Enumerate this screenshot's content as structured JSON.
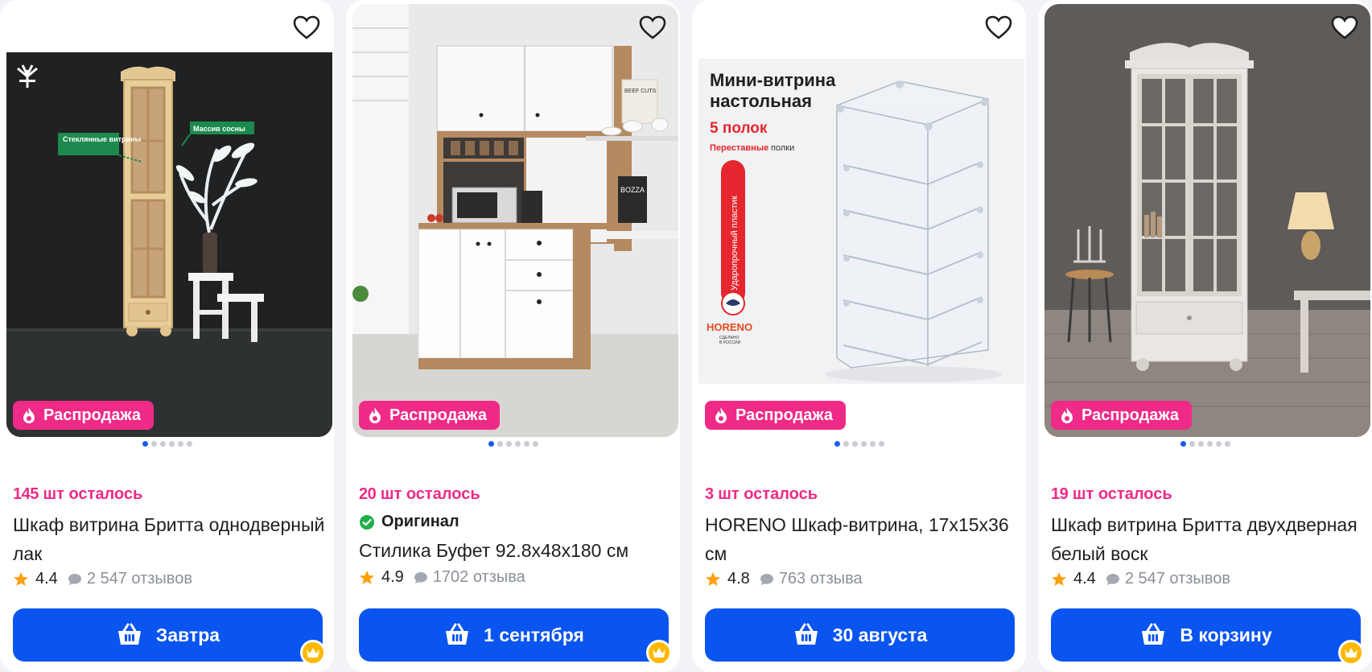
{
  "colors": {
    "accent_blue": "#0a55f0",
    "sale_pink": "#ef2a87",
    "stock_pink": "#ef2a87",
    "star_orange": "#ff9f0a",
    "muted_text": "#8a8f99",
    "premium_yellow": "#ffb800"
  },
  "products": [
    {
      "image_texts": {
        "label_left": "Стеклянные витрины",
        "label_right": "Массив сосны"
      },
      "badge": "Распродажа",
      "stock_num": "145",
      "stock_text": "шт осталось",
      "title": "Шкаф витрина Бритта однодверный лак",
      "rating": "4.4",
      "reviews": "2 547 отзывов",
      "button": "Завтра"
    },
    {
      "image_texts": {
        "board": "BEEF CUTS",
        "box": "BOZZA"
      },
      "badge": "Распродажа",
      "stock_num": "20",
      "stock_text": "шт осталось",
      "original": "Оригинал",
      "title": "Стилика Буфет 92.8x48x180 см",
      "rating": "4.9",
      "reviews": "1702 отзыва",
      "button": "1 сентября"
    },
    {
      "image_texts": {
        "headline_1": "Мини-витрина",
        "headline_2": "настольная",
        "shelves": "5 полок",
        "movable_bold": "Переставные",
        "movable_rest": " полки",
        "vertical": "Ударопрочный пластик",
        "brand": "HORENO",
        "made_1": "СДЕЛАНО",
        "made_2": "В РОССИИ"
      },
      "badge": "Распродажа",
      "stock_num": "3",
      "stock_text": "шт осталось",
      "title": "HORENO Шкаф-витрина, 17x15x36 см",
      "rating": "4.8",
      "reviews": "763 отзыва",
      "button": "30 августа"
    },
    {
      "badge": "Распродажа",
      "stock_num": "19",
      "stock_text": "шт осталось",
      "title": "Шкаф витрина Бритта двухдверная белый воск",
      "rating": "4.4",
      "reviews": "2 547 отзывов",
      "button": "В корзину"
    }
  ]
}
